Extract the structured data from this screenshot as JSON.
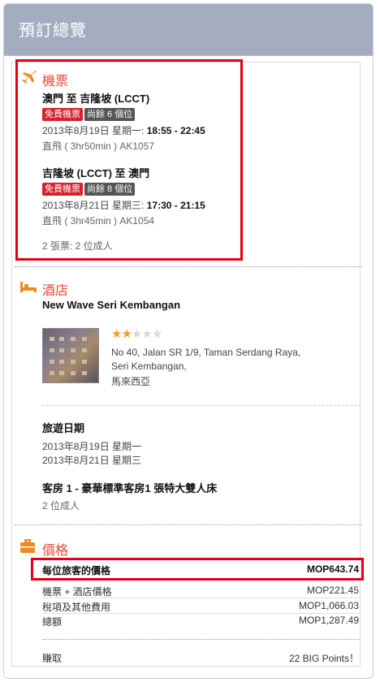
{
  "header": {
    "title": "預訂總覽"
  },
  "flights": {
    "title": "機票",
    "outbound": {
      "route": "澳門 至 吉隆坡 (LCCT)",
      "badge_free": "免費機票",
      "badge_seats": "尚餘 6 個位",
      "date_prefix": "2013年8月19日 星期一: ",
      "time": "18:55 - 22:45",
      "info": "直飛 ( 3hr50min ) AK1057"
    },
    "return": {
      "route": "吉隆坡 (LCCT) 至 澳門",
      "badge_free": "免費機票",
      "badge_seats": "尚餘 8 個位",
      "date_prefix": "2013年8月21日 星期三: ",
      "time": "17:30 - 21:15",
      "info": "直飛 ( 3hr45min ) AK1054"
    },
    "summary": "2 張票:  2 位成人"
  },
  "hotel": {
    "title": "酒店",
    "name": "New Wave Seri Kembangan",
    "rating": 2,
    "rating_max": 5,
    "address_line1": "No 40, Jalan SR 1/9, Taman Serdang Raya,",
    "address_line2": "Seri Kembangan,",
    "address_line3": "馬來西亞",
    "travel_dates_label": "旅遊日期",
    "date_in": "2013年8月19日 星期一",
    "date_out": "2013年8月21日 星期三",
    "room": "客房 1 - 豪華標準客房1 張特大雙人床",
    "guests": "2 位成人"
  },
  "price": {
    "title": "價格",
    "per_person_label": "每位旅客的價格",
    "per_person_value": "MOP643.74",
    "rows": [
      {
        "label": "機票 + 酒店價格",
        "value": "MOP221.45"
      },
      {
        "label": "稅項及其他費用",
        "value": "MOP1,066.03"
      },
      {
        "label": "總額",
        "value": "MOP1,287.49"
      }
    ],
    "earn_label": "賺取",
    "earn_value": "22 BIG Points！"
  },
  "colors": {
    "accent": "#e8473a",
    "icon_orange": "#f08a1e",
    "highlight_border": "#e00016",
    "header_bg": "#a4adbf"
  }
}
